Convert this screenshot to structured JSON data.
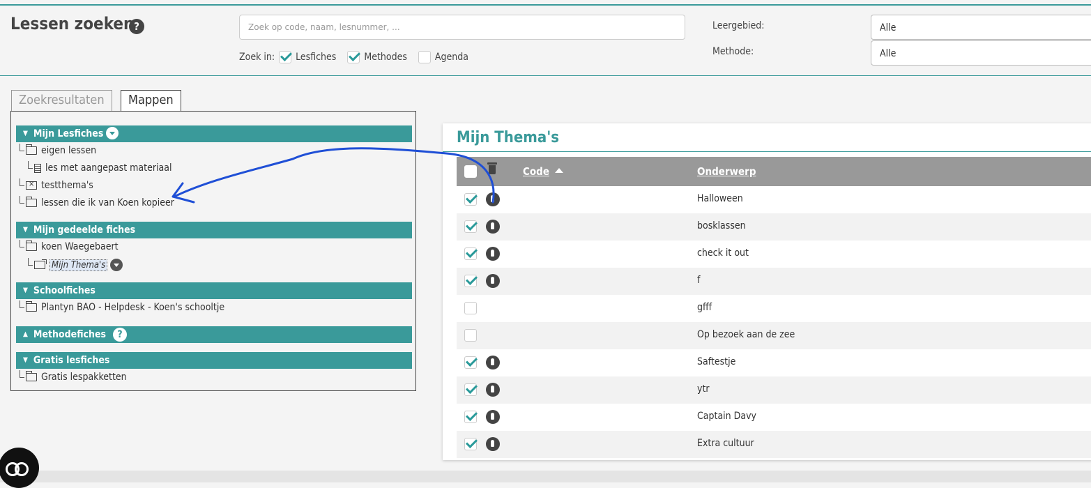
{
  "header": {
    "title": "Lessen zoeken",
    "help_glyph": "?",
    "search_placeholder": "Zoek op code, naam, lesnummer, ...",
    "zoek_in_label": "Zoek in:",
    "options": [
      {
        "label": "Lesfiches",
        "checked": true
      },
      {
        "label": "Methodes",
        "checked": true
      },
      {
        "label": "Agenda",
        "checked": false
      }
    ],
    "leergebied_label": "Leergebied:",
    "leergebied_value": "Alle",
    "methode_label": "Methode:",
    "methode_value": "Alle"
  },
  "tabs": [
    {
      "label": "Zoekresultaten",
      "active": false
    },
    {
      "label": "Mappen",
      "active": true
    }
  ],
  "tree": {
    "mijn_lesfiches": "Mijn Lesfiches",
    "eigen_lessen": "eigen lessen",
    "les_aangepast": "les met aangepast materiaal",
    "testthemas": "testthema's",
    "lessen_koen": "lessen die ik van Koen kopieer",
    "gedeelde_fiches": "Mijn gedeelde fiches",
    "koen": "koen Waegebaert",
    "mijn_themas_item": "Mijn Thema's",
    "schoolfiches": "Schoolfiches",
    "plantyn": "Plantyn BAO - Helpdesk - Koen's schooltje",
    "methodefiches": "Methodefiches",
    "methode_help_glyph": "?",
    "gratis_lesfiches": "Gratis lesfiches",
    "gratis_lespakketten": "Gratis lespakketten"
  },
  "panel": {
    "title": "Mijn Thema's",
    "col_code": "Code",
    "col_onderwerp": "Onderwerp",
    "rows": [
      {
        "onderwerp": "Halloween",
        "checked": true
      },
      {
        "onderwerp": "bosklassen",
        "checked": true
      },
      {
        "onderwerp": "check it out",
        "checked": true
      },
      {
        "onderwerp": "f",
        "checked": true
      },
      {
        "onderwerp": "gfff",
        "checked": false
      },
      {
        "onderwerp": "Op bezoek aan de zee",
        "checked": false
      },
      {
        "onderwerp": "Saftestje",
        "checked": true
      },
      {
        "onderwerp": "ytr",
        "checked": true
      },
      {
        "onderwerp": "Captain Davy",
        "checked": true
      },
      {
        "onderwerp": "Extra cultuur",
        "checked": true
      }
    ]
  },
  "colors": {
    "accent": "#3a9a9a",
    "annotation": "#1f4fd6",
    "table_header": "#999999"
  }
}
